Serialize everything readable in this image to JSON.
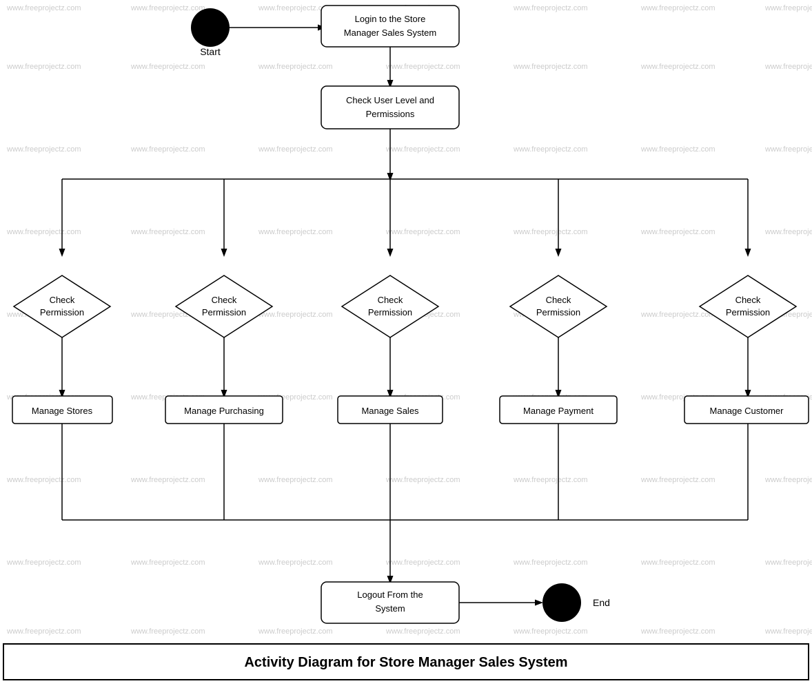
{
  "diagram": {
    "title": "Activity Diagram for Store Manager Sales System",
    "watermark_text": "www.freeprojectz.com",
    "nodes": {
      "start_label": "Start",
      "login_label": "Login to the Store\nManager Sales System",
      "check_user_label": "Check User Level and\nPermissions",
      "check_perm1": "Check\nPermission",
      "check_perm2": "Check\nPermission",
      "check_perm3": "Check\nPermission",
      "check_perm4": "Check\nPermission",
      "check_perm5": "Check\nPermission",
      "manage_stores": "Manage Stores",
      "manage_purchasing": "Manage Purchasing",
      "manage_sales": "Manage Sales",
      "manage_payment": "Manage Payment",
      "manage_customer": "Manage Customer",
      "logout_label": "Logout From the\nSystem",
      "end_label": "End"
    }
  }
}
